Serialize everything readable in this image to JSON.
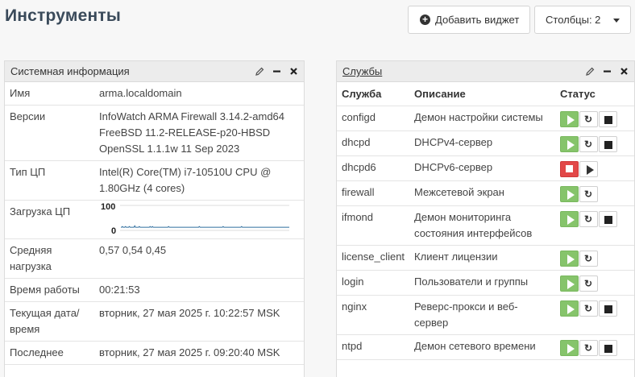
{
  "page": {
    "title": "Инструменты",
    "add_widget_label": "Добавить виджет",
    "columns_label": "Столбцы: 2"
  },
  "sysinfo": {
    "title": "Системная информация",
    "rows": [
      {
        "key": "Имя",
        "value": "arma.localdomain"
      },
      {
        "key": "Версии",
        "lines": [
          "InfoWatch ARMA Firewall 3.14.2-amd64",
          "FreeBSD 11.2-RELEASE-p20-HBSD",
          "OpenSSL 1.1.1w 11 Sep 2023"
        ]
      },
      {
        "key": "Тип ЦП",
        "lines": [
          "Intel(R) Core(TM) i7-10510U CPU @",
          "1.80GHz (4 cores)"
        ]
      },
      {
        "key": "Загрузка ЦП",
        "cpu_max_label": "100",
        "cpu_min_label": "0"
      },
      {
        "key_lines": [
          "Средняя",
          "нагрузка"
        ],
        "value": "0,57 0,54 0,45"
      },
      {
        "key": "Время работы",
        "value": "00:21:53"
      },
      {
        "key_lines": [
          "Текущая дата/",
          "время"
        ],
        "value": "вторник, 27 мая 2025 г. 10:22:57 MSK"
      },
      {
        "key": "Последнее",
        "value": "вторник, 27 мая 2025 г. 09:20:40 MSK"
      }
    ],
    "cpu_series": [
      2,
      2,
      3,
      2,
      2,
      2,
      3,
      2,
      2,
      2,
      2,
      3,
      2,
      2,
      2,
      2,
      2,
      2,
      4,
      2,
      2,
      2,
      2,
      2,
      3,
      2,
      2,
      2,
      2,
      2,
      2,
      2,
      2,
      2,
      2,
      2,
      2,
      2,
      3,
      2,
      2,
      3,
      2,
      2,
      2,
      2,
      2,
      2,
      2,
      2,
      2,
      2,
      2,
      2,
      2,
      2,
      2,
      2,
      2,
      2,
      2,
      2,
      3,
      2,
      2,
      2,
      2,
      2,
      2,
      2,
      2,
      2,
      2,
      2,
      2,
      2,
      2,
      2,
      2,
      2,
      2,
      2,
      2,
      2,
      2,
      2,
      2,
      2,
      2,
      2,
      2,
      2,
      2,
      2,
      2,
      2,
      2,
      2,
      2,
      2,
      2,
      2,
      3,
      2,
      2,
      2,
      2,
      2,
      2,
      2,
      2,
      2,
      2,
      2,
      2,
      2,
      2,
      2,
      2,
      2,
      2,
      2,
      2,
      2,
      2,
      2,
      2,
      2,
      2,
      2,
      2,
      2,
      2,
      3,
      2,
      2,
      2,
      2,
      2,
      2,
      2,
      2,
      2,
      2,
      2,
      2,
      2,
      2,
      2,
      2,
      2,
      2,
      2,
      2,
      2,
      2,
      2,
      3,
      2,
      2,
      2,
      2,
      2,
      2,
      2,
      2,
      2,
      2,
      2,
      2,
      2,
      2,
      2,
      2,
      2,
      2,
      2,
      2,
      2,
      2,
      2,
      2,
      2,
      2,
      2,
      2,
      2,
      2,
      2,
      2,
      2,
      2,
      2,
      2,
      2,
      2,
      2,
      2,
      2,
      2,
      2,
      2,
      2,
      2,
      2,
      2,
      2,
      2,
      2,
      2,
      2,
      2,
      2,
      2,
      2,
      2,
      2,
      2,
      2,
      2
    ]
  },
  "services": {
    "title": "Службы",
    "headers": {
      "service": "Служба",
      "description": "Описание",
      "status": "Статус"
    },
    "rows": [
      {
        "name": "configd",
        "lines": [
          "Демон настройки системы"
        ],
        "running": true,
        "stoppable": true
      },
      {
        "name": "dhcpd",
        "lines": [
          "DHCPv4-сервер"
        ],
        "running": true,
        "stoppable": true
      },
      {
        "name": "dhcpd6",
        "lines": [
          "DHCPv6-сервер"
        ],
        "running": false,
        "stoppable": false
      },
      {
        "name": "firewall",
        "lines": [
          "Межсетевой экран"
        ],
        "running": true,
        "stoppable": false
      },
      {
        "name": "ifmond",
        "lines": [
          "Демон мониторинга",
          "состояния интерфейсов"
        ],
        "running": true,
        "stoppable": true
      },
      {
        "name": "license_client",
        "lines": [
          "Клиент лицензии"
        ],
        "running": true,
        "stoppable": false
      },
      {
        "name": "login",
        "lines": [
          "Пользователи и группы"
        ],
        "running": true,
        "stoppable": false
      },
      {
        "name": "nginx",
        "lines": [
          "Реверс-прокси и веб-",
          "сервер"
        ],
        "running": true,
        "stoppable": true
      },
      {
        "name": "ntpd",
        "lines": [
          "Демон сетевого времени"
        ],
        "running": true,
        "stoppable": true
      }
    ]
  },
  "colors": {
    "running": "#86c46b",
    "stopped": "#e24848",
    "sparkline": "#2f6e9e"
  }
}
